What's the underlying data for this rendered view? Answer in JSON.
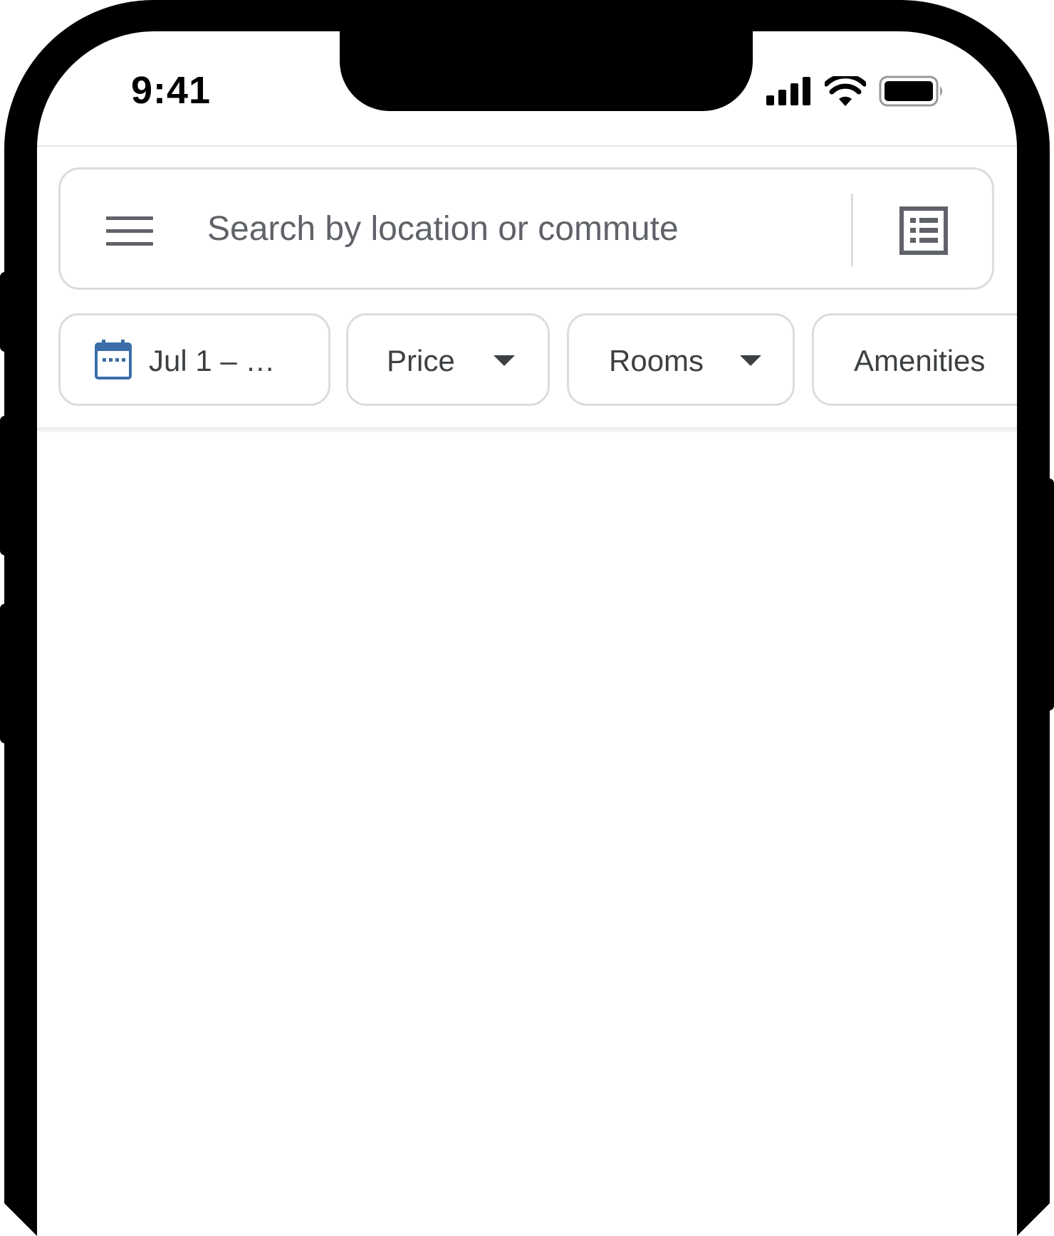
{
  "status_bar": {
    "time": "9:41"
  },
  "search": {
    "placeholder": "Search by location or commute"
  },
  "filters": {
    "dates_label": "Jul 1  – …",
    "price_label": "Price",
    "rooms_label": "Rooms",
    "amenities_label": "Amenities"
  },
  "colors": {
    "icon_gray": "#5f6368",
    "calendar_blue": "#3b6ea8",
    "border": "#dcdcdc"
  },
  "icons": [
    "menu-icon",
    "list-view-icon",
    "calendar-icon",
    "caret-down-icon",
    "cellular-signal-icon",
    "wifi-icon",
    "battery-icon"
  ]
}
